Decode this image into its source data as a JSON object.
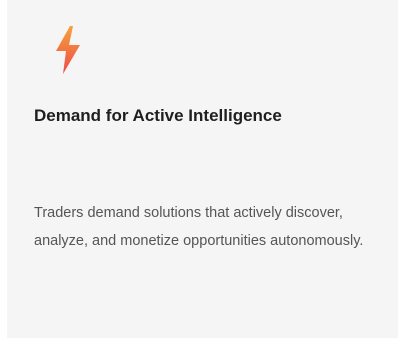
{
  "card": {
    "icon": "lightning-bolt-icon",
    "title": "Demand for Active Intelligence",
    "description": "Traders demand solutions that actively discover, analyze, and monetize opportunities autonomously."
  },
  "colors": {
    "card_background": "#f5f5f5",
    "title_text": "#1f1f1f",
    "description_text": "#555555",
    "icon_gradient_top": "#f5a23a",
    "icon_gradient_bottom": "#ef4a4a"
  }
}
